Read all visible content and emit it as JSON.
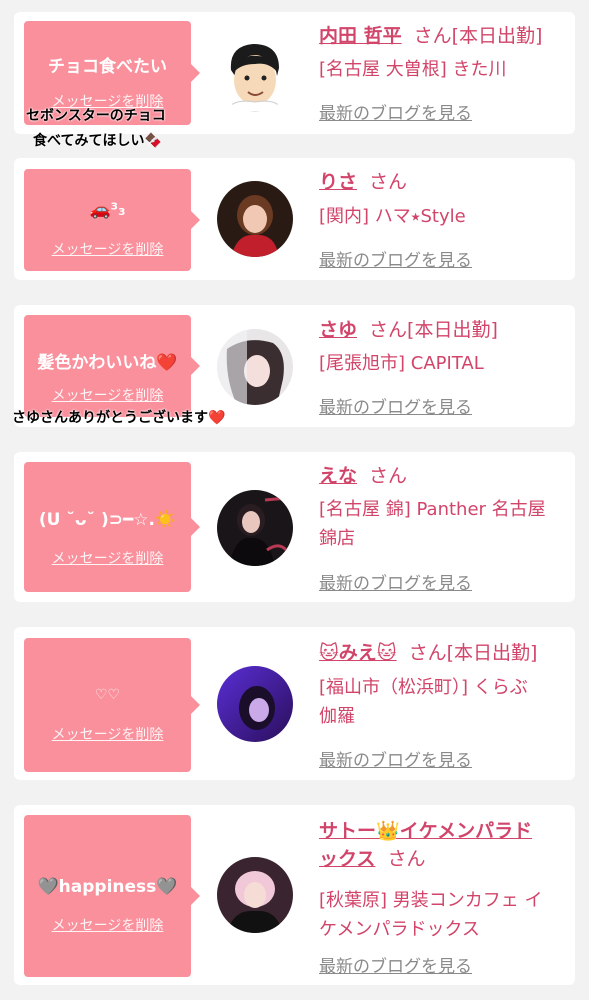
{
  "colors": {
    "page_bg": "#f2f2f2",
    "card_bg": "#ffffff",
    "bubble_bg": "#f9909c",
    "accent_text": "#d2456a",
    "link_gray": "#8a8a8a"
  },
  "cards": [
    {
      "message": "チョコ食べたい",
      "delete_label": "メッセージを削除",
      "reply": "セボンスターのチョコ 食べてみてほしい🍫",
      "reply_line1": "セボンスターのチョコ",
      "reply_line2": "食べてみてほしい🍫",
      "name": "内田 哲平",
      "honorific": "さん",
      "status": "[本日出勤]",
      "info_line1": "[名古屋 大曽根] きた川",
      "info_line2": "",
      "blog_label": "最新のブログを見る",
      "avatar_icon": "cartoon-man-avatar"
    },
    {
      "message": "🚗³₃",
      "delete_label": "メッセージを削除",
      "reply": "",
      "name": "りさ",
      "honorific": "さん",
      "status": "",
      "info_line1": "[関内] ハマ⭑Style",
      "info_line2": "",
      "blog_label": "最新のブログを見る",
      "avatar_icon": "woman-photo-avatar"
    },
    {
      "message": "髪色かわいいね❤️",
      "delete_label": "メッセージを削除",
      "reply": "さゆさんありがとうございます❤️",
      "name": "さゆ",
      "honorific": "さん",
      "status": "[本日出勤]",
      "info_line1": "[尾張旭市] CAPITAL",
      "info_line2": "",
      "blog_label": "最新のブログを見る",
      "avatar_icon": "woman-photo-avatar"
    },
    {
      "message": "(U ˘ᴗ˘ )⊃━☆.☀️",
      "delete_label": "メッセージを削除",
      "reply": "",
      "name": "えな",
      "honorific": "さん",
      "status": "",
      "info_line1": "[名古屋 錦] Panther 名古屋",
      "info_line2": "錦店",
      "blog_label": "最新のブログを見る",
      "avatar_icon": "woman-photo-avatar"
    },
    {
      "message": "♡♡",
      "delete_label": "メッセージを削除",
      "reply": "",
      "name": "🐱みえ🐱",
      "honorific": "さん",
      "status": "[本日出勤]",
      "info_line1": "[福山市（松浜町）] くらぶ",
      "info_line2": "伽羅",
      "blog_label": "最新のブログを見る",
      "avatar_icon": "woman-photo-avatar"
    },
    {
      "message": "🩶happiness🩶",
      "delete_label": "メッセージを削除",
      "reply": "",
      "name": "サトー👑イケメンパラド",
      "name2": "ックス",
      "honorific": "さん",
      "status": "",
      "info_line1": "[秋葉原] 男装コンカフェ イ",
      "info_line2": "ケメンパラドックス",
      "blog_label": "最新のブログを見る",
      "avatar_icon": "woman-photo-avatar"
    }
  ]
}
